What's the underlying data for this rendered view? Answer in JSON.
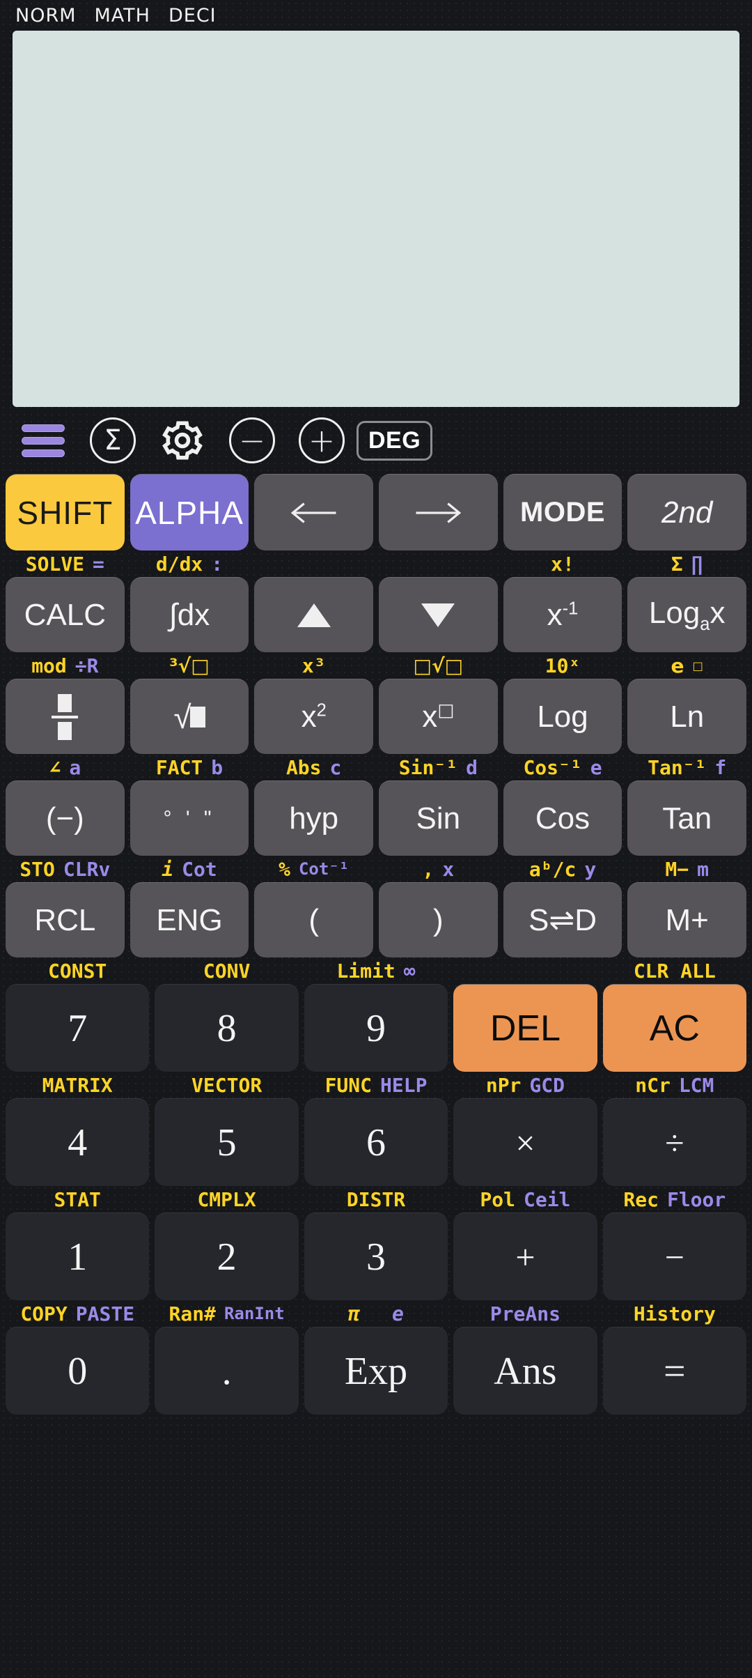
{
  "statusbar": {
    "items": [
      "NORM",
      "MATH",
      "DECI"
    ]
  },
  "display": {
    "value": ""
  },
  "toolbar": {
    "menu": "menu-icon",
    "sigma": "Σ",
    "gear": "gear-icon",
    "minus": "−",
    "plus": "+",
    "angle_mode": "DEG"
  },
  "keypad": {
    "row_shift": [
      {
        "label": "SHIFT",
        "style": "shift"
      },
      {
        "label": "ALPHA",
        "style": "alpha"
      },
      {
        "label": "←",
        "style": "arrow-left"
      },
      {
        "label": "→",
        "style": "arrow-right"
      },
      {
        "label": "MODE",
        "style": "mode"
      },
      {
        "label": "2nd",
        "style": "italic"
      }
    ],
    "labels_calc": [
      {
        "yellow": "SOLVE",
        "purple": "="
      },
      {
        "yellow": "d/dx",
        "purple": ":"
      },
      {
        "yellow": "",
        "purple": ""
      },
      {
        "yellow": "",
        "purple": ""
      },
      {
        "yellow": "x!",
        "purple": ""
      },
      {
        "yellow": "Σ",
        "purple": "∏"
      }
    ],
    "row_calc": [
      "CALC",
      "∫dx",
      "▲",
      "▼",
      "x⁻¹",
      "Logₐx"
    ],
    "labels_frac": [
      {
        "yellow": "mod",
        "purple": "÷R"
      },
      {
        "yellow": "³√□",
        "purple": ""
      },
      {
        "yellow": "x³",
        "purple": ""
      },
      {
        "yellow": "□√□",
        "purple": ""
      },
      {
        "yellow": "10ˣ",
        "purple": ""
      },
      {
        "yellow": "e^□",
        "purple": ""
      }
    ],
    "row_frac": [
      "fraction",
      "√□",
      "x²",
      "x^□",
      "Log",
      "Ln"
    ],
    "labels_trig": [
      {
        "yellow": "∠",
        "purple": "a"
      },
      {
        "yellow": "FACT",
        "purple": "b"
      },
      {
        "yellow": "Abs",
        "purple": "c"
      },
      {
        "yellow": "Sin⁻¹",
        "purple": "d"
      },
      {
        "yellow": "Cos⁻¹",
        "purple": "e"
      },
      {
        "yellow": "Tan⁻¹",
        "purple": "f"
      }
    ],
    "row_trig": [
      "(−)",
      "° ' \"",
      "hyp",
      "Sin",
      "Cos",
      "Tan"
    ],
    "labels_mem": [
      {
        "yellow": "STO",
        "purple": "CLRv"
      },
      {
        "yellow": "i",
        "purple": "Cot"
      },
      {
        "yellow": "%",
        "purple": "Cot⁻¹"
      },
      {
        "yellow": ",",
        "purple": "x"
      },
      {
        "yellow": "aᵇ/c",
        "purple": "y"
      },
      {
        "yellow": "M−",
        "purple": "m"
      }
    ],
    "row_mem": [
      "RCL",
      "ENG",
      "(",
      ")",
      "S⇌D",
      "M+"
    ],
    "labels_789": [
      {
        "yellow": "CONST",
        "purple": ""
      },
      {
        "yellow": "CONV",
        "purple": ""
      },
      {
        "yellow": "Limit",
        "purple": "∞"
      },
      {
        "yellow": "",
        "purple": ""
      },
      {
        "yellow": "CLR ALL",
        "purple": ""
      }
    ],
    "row_789": [
      {
        "label": "7",
        "style": "dark"
      },
      {
        "label": "8",
        "style": "dark"
      },
      {
        "label": "9",
        "style": "dark"
      },
      {
        "label": "DEL",
        "style": "orange"
      },
      {
        "label": "AC",
        "style": "orange"
      }
    ],
    "labels_456": [
      {
        "yellow": "MATRIX",
        "purple": ""
      },
      {
        "yellow": "VECTOR",
        "purple": ""
      },
      {
        "yellow": "FUNC",
        "purple": "HELP"
      },
      {
        "yellow": "nPr",
        "purple": "GCD"
      },
      {
        "yellow": "nCr",
        "purple": "LCM"
      }
    ],
    "row_456": [
      "4",
      "5",
      "6",
      "×",
      "÷"
    ],
    "labels_123": [
      {
        "yellow": "STAT",
        "purple": ""
      },
      {
        "yellow": "CMPLX",
        "purple": ""
      },
      {
        "yellow": "DISTR",
        "purple": ""
      },
      {
        "yellow": "Pol",
        "purple": "Ceil"
      },
      {
        "yellow": "Rec",
        "purple": "Floor"
      }
    ],
    "row_123": [
      "1",
      "2",
      "3",
      "+",
      "−"
    ],
    "labels_0": [
      {
        "yellow": "COPY",
        "purple": "PASTE"
      },
      {
        "yellow": "Ran#",
        "purple": "RanInt"
      },
      {
        "yellow": "π",
        "purple": "e"
      },
      {
        "yellow": "",
        "purple": "PreAns"
      },
      {
        "yellow": "History",
        "purple": ""
      }
    ],
    "row_0": [
      "0",
      ".",
      "Exp",
      "Ans",
      "="
    ]
  },
  "colors": {
    "shift": "#fbc93d",
    "alpha": "#7b6fd0",
    "orange": "#ec9553",
    "yellow_label": "#ffd426",
    "purple_label": "#9b8ae8",
    "display_bg": "#d5e2e0",
    "key_bg": "#565459",
    "num_bg": "#25272c"
  }
}
